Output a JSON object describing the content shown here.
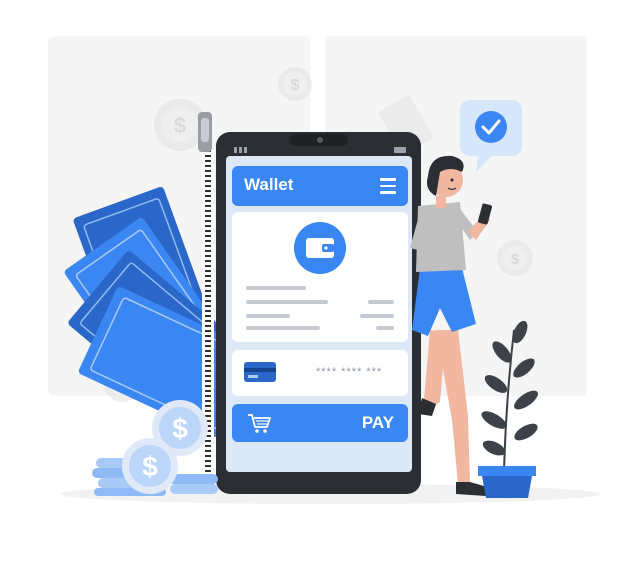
{
  "wallet": {
    "title": "Wallet",
    "card_number": "**** **** ***",
    "pay_label": "PAY"
  },
  "icons": {
    "menu": "menu-icon",
    "wallet": "wallet-icon",
    "card": "credit-card-icon",
    "cart": "shopping-cart-icon",
    "check": "checkmark-icon",
    "dollar": "dollar-coin-icon"
  },
  "colors": {
    "accent": "#3a86f2",
    "accent_dark": "#2a67c8",
    "phone_body": "#2b2f33",
    "screen": "#dde8f6",
    "skin": "#f1b7a0",
    "shirt": "#bfbfbf",
    "shorts": "#3a86f2",
    "plant_leaf": "#3d4248"
  }
}
